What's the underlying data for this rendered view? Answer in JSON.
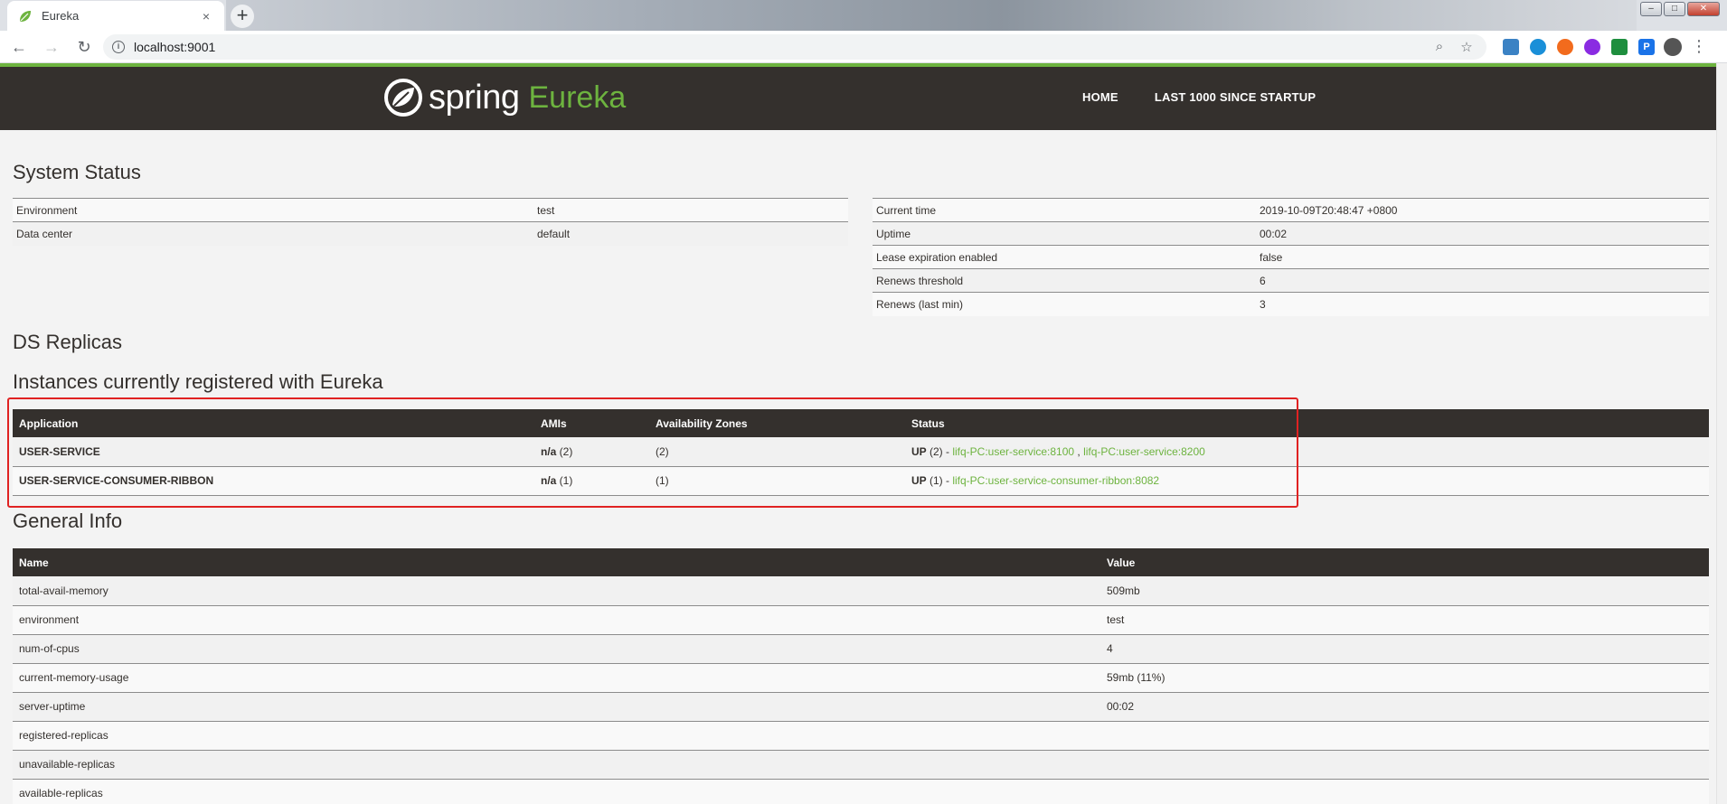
{
  "browser": {
    "tab_title": "Eureka",
    "tab_close": "×",
    "new_tab": "+",
    "url": "localhost:9001"
  },
  "header": {
    "brand_spring": "spring",
    "brand_eureka": "Eureka",
    "nav": [
      "HOME",
      "LAST 1000 SINCE STARTUP"
    ]
  },
  "system_status": {
    "title": "System Status",
    "left": [
      {
        "key": "Environment",
        "value": "test"
      },
      {
        "key": "Data center",
        "value": "default"
      }
    ],
    "right": [
      {
        "key": "Current time",
        "value": "2019-10-09T20:48:47 +0800"
      },
      {
        "key": "Uptime",
        "value": "00:02"
      },
      {
        "key": "Lease expiration enabled",
        "value": "false"
      },
      {
        "key": "Renews threshold",
        "value": "6"
      },
      {
        "key": "Renews (last min)",
        "value": "3"
      }
    ]
  },
  "ds_replicas": {
    "title": "DS Replicas"
  },
  "instances": {
    "title": "Instances currently registered with Eureka",
    "columns": [
      "Application",
      "AMIs",
      "Availability Zones",
      "Status"
    ],
    "rows": [
      {
        "application": "USER-SERVICE",
        "amis_bold": "n/a",
        "amis_count": " (2)",
        "zones": "(2)",
        "status_bold": "UP",
        "status_count": " (2) - ",
        "link1": "lifq-PC:user-service:8100",
        "sep": " , ",
        "link2": "lifq-PC:user-service:8200"
      },
      {
        "application": "USER-SERVICE-CONSUMER-RIBBON",
        "amis_bold": "n/a",
        "amis_count": " (1)",
        "zones": "(1)",
        "status_bold": "UP",
        "status_count": " (1) - ",
        "link1": "lifq-PC:user-service-consumer-ribbon:8082"
      }
    ]
  },
  "general_info": {
    "title": "General Info",
    "columns": [
      "Name",
      "Value"
    ],
    "rows": [
      {
        "name": "total-avail-memory",
        "value": "509mb"
      },
      {
        "name": "environment",
        "value": "test"
      },
      {
        "name": "num-of-cpus",
        "value": "4"
      },
      {
        "name": "current-memory-usage",
        "value": "59mb (11%)"
      },
      {
        "name": "server-uptime",
        "value": "00:02"
      },
      {
        "name": "registered-replicas",
        "value": ""
      },
      {
        "name": "unavailable-replicas",
        "value": ""
      },
      {
        "name": "available-replicas",
        "value": ""
      }
    ]
  },
  "colors": {
    "brand_green": "#6db33f",
    "header_dark": "#34302d",
    "highlight_red": "#e02222"
  }
}
